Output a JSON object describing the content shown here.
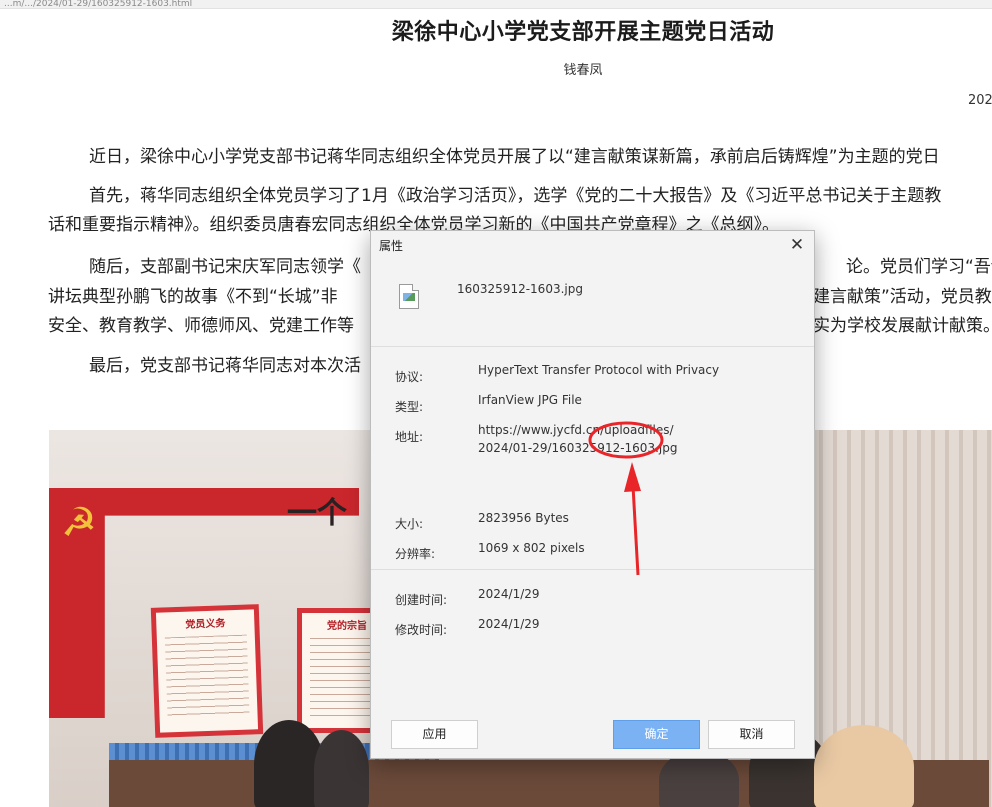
{
  "browser": {
    "url_fragment": "...m/.../2024/01-29/160325912-1603.html"
  },
  "article": {
    "title": "梁徐中心小学党支部开展主题党日活动",
    "author": "钱春凤",
    "date": "202",
    "paragraphs": [
      "近日，梁徐中心小学党支部书记蒋华同志组织全体党员开展了以“建言献策谋新篇，承前启后铸辉煌”为主题的党日",
      "首先，蒋华同志组织全体党员学习了1月《政治学习活页》，选学《党的二十大报告》及《习近平总书记关于主题教",
      "话和重要指示精神》。组织委员唐春宏同志组织全体党员学习新的《中国共产党章程》之《总纲》。",
      "随后，支部副书记宋庆军同志领学《",
      "论。党员们学习“吾论",
      "讲坛典型孙鹏飞的故事《不到“长城”非",
      "建言献策”活动，党员教",
      "安全、教育教学、师德师风、党建工作等",
      "实为学校发展献计献策。",
      "最后，党支部书记蒋华同志对本次活"
    ]
  },
  "photo": {
    "slogan": "一个",
    "board1_title": "党员义务",
    "board2_title": "党的宗旨"
  },
  "dialog": {
    "title": "属性",
    "file_name": "160325912-1603.jpg",
    "labels": {
      "protocol": "协议:",
      "type": "类型:",
      "address": "地址:",
      "size": "大小:",
      "resolution": "分辨率:",
      "created": "创建时间:",
      "modified": "修改时间:"
    },
    "values": {
      "protocol": "HyperText Transfer Protocol with Privacy",
      "type": "IrfanView JPG File",
      "address_line1": "https://www.jycfd.cn/uploadfiles/",
      "address_line2": "2024/01-29/160325912-1603.jpg",
      "size": "2823956 Bytes",
      "resolution": "1069 x 802 pixels",
      "created": "2024/1/29",
      "modified": "2024/1/29"
    },
    "buttons": {
      "apply": "应用",
      "ok": "确定",
      "cancel": "取消"
    }
  },
  "colors": {
    "annotation_red": "#e8262a",
    "primary_button": "#7ab2f4"
  }
}
